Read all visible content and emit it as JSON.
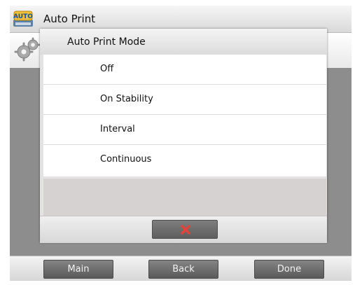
{
  "header": {
    "title": "Auto Print",
    "app_icon": "auto-print-icon",
    "app_icon_text": "AUTO"
  },
  "settings_row": {
    "icon": "gear-icon"
  },
  "dialog": {
    "title": "Auto Print Mode",
    "options": [
      {
        "label": "Off"
      },
      {
        "label": "On Stability"
      },
      {
        "label": "Interval"
      },
      {
        "label": "Continuous"
      }
    ],
    "cancel_icon": "close-icon",
    "cancel_icon_color": "#e0453a"
  },
  "footer": {
    "main_label": "Main",
    "back_label": "Back",
    "done_label": "Done"
  }
}
